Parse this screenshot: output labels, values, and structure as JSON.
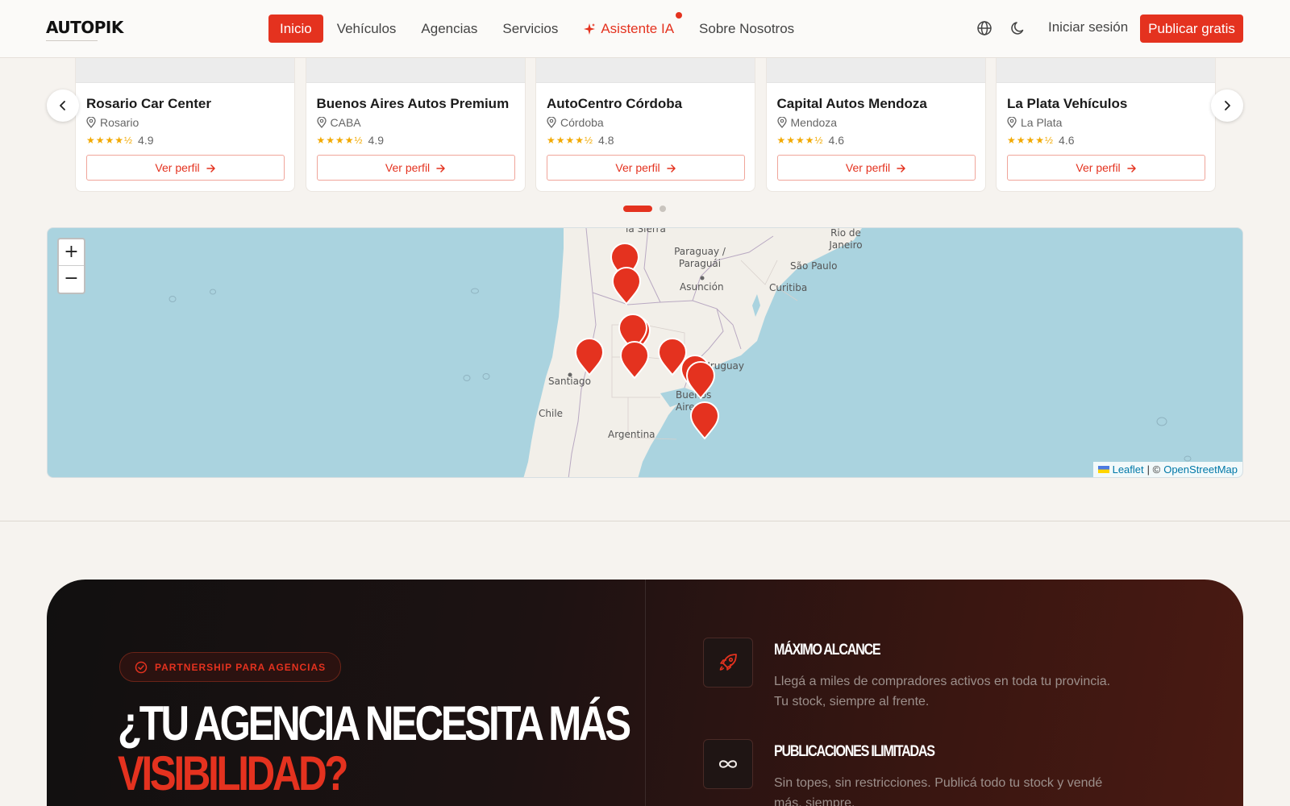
{
  "header": {
    "logo": "AUTOPIK",
    "nav": [
      {
        "label": "Inicio",
        "active": true
      },
      {
        "label": "Vehículos"
      },
      {
        "label": "Agencias"
      },
      {
        "label": "Servicios"
      },
      {
        "label": "Asistente IA",
        "icon": "sparkle-icon",
        "badge": true
      },
      {
        "label": "Sobre Nosotros"
      }
    ],
    "login": "Iniciar sesión",
    "publish": "Publicar gratis"
  },
  "agencies": [
    {
      "name": "Rosario Car Center",
      "location": "Rosario",
      "rating": "4.9",
      "stars": "★★★★½",
      "cta": "Ver perfil"
    },
    {
      "name": "Buenos Aires Autos Premium",
      "location": "CABA",
      "rating": "4.9",
      "stars": "★★★★½",
      "cta": "Ver perfil"
    },
    {
      "name": "AutoCentro Córdoba",
      "location": "Córdoba",
      "rating": "4.8",
      "stars": "★★★★½",
      "cta": "Ver perfil"
    },
    {
      "name": "Capital Autos Mendoza",
      "location": "Mendoza",
      "rating": "4.6",
      "stars": "★★★★½",
      "cta": "Ver perfil"
    },
    {
      "name": "La Plata Vehículos",
      "location": "La Plata",
      "rating": "4.6",
      "stars": "★★★★½",
      "cta": "Ver perfil"
    }
  ],
  "carousel": {
    "pages": 2,
    "current": 1
  },
  "map": {
    "zoom_in": "+",
    "zoom_out": "−",
    "labels": [
      "la Sierra",
      "Paraguay / Paraguái",
      "Asunción",
      "Rio de Janeiro",
      "São Paulo",
      "Curitiba",
      "Santiago",
      "Chile",
      "Argentina",
      "Uruguay",
      "Buenos Aires"
    ],
    "attribution": {
      "leaflet": "Leaflet",
      "separator": "| ©",
      "osm": "OpenStreetMap"
    },
    "markers": 10
  },
  "promo": {
    "badge": "PARTNERSHIP PARA AGENCIAS",
    "title_line1": "¿TU AGENCIA NECESITA MÁS",
    "title_line2": "VISIBILIDAD?",
    "features": [
      {
        "title": "MÁXIMO ALCANCE",
        "desc": "Llegá a miles de compradores activos en toda tu provincia. Tu stock, siempre al frente.",
        "icon": "rocket-icon"
      },
      {
        "title": "PUBLICACIONES ILIMITADAS",
        "desc": "Sin topes, sin restricciones. Publicá todo tu stock y vendé más, siempre.",
        "icon": "infinity-icon"
      }
    ]
  },
  "colors": {
    "accent": "#e4321f",
    "star": "#f2a900",
    "water": "#aad3df"
  }
}
